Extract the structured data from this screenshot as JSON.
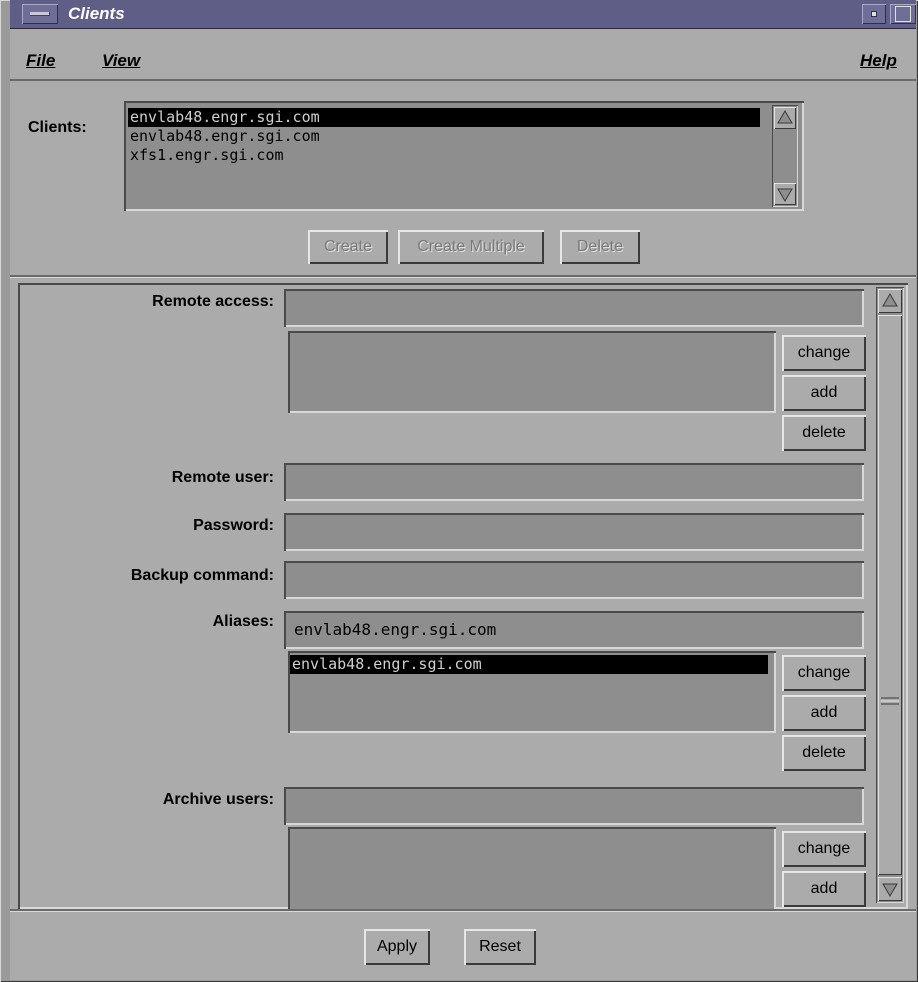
{
  "window": {
    "title": "Clients"
  },
  "menubar": {
    "file": "File",
    "view": "View",
    "help": "Help"
  },
  "clients": {
    "label": "Clients:",
    "items": [
      "envlab48.engr.sgi.com",
      "envlab48.engr.sgi.com",
      "xfs1.engr.sgi.com"
    ],
    "selected_index": 0
  },
  "client_buttons": {
    "create": "Create",
    "create_multiple": "Create Multiple",
    "delete": "Delete"
  },
  "form": {
    "remote_access": {
      "label": "Remote access:",
      "value": "",
      "buttons": {
        "change": "change",
        "add": "add",
        "delete": "delete"
      }
    },
    "remote_user": {
      "label": "Remote user:",
      "value": ""
    },
    "password": {
      "label": "Password:",
      "value": ""
    },
    "backup_command": {
      "label": "Backup command:",
      "value": ""
    },
    "aliases": {
      "label": "Aliases:",
      "value": "envlab48.engr.sgi.com",
      "items": [
        "envlab48.engr.sgi.com"
      ],
      "buttons": {
        "change": "change",
        "add": "add",
        "delete": "delete"
      }
    },
    "archive_users": {
      "label": "Archive users:",
      "value": "",
      "buttons": {
        "change": "change",
        "add": "add"
      }
    }
  },
  "footer": {
    "apply": "Apply",
    "reset": "Reset"
  }
}
